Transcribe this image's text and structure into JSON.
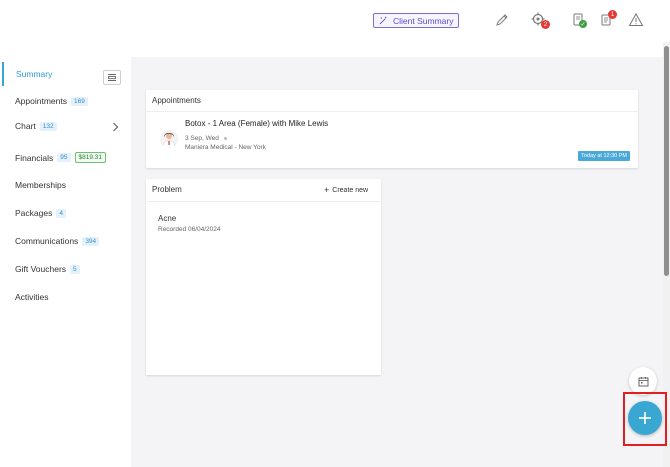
{
  "header": {
    "client_summary_label": "Client Summary",
    "icons": [
      "edit-icon",
      "target-icon",
      "document-check-icon",
      "notes-icon",
      "warning-icon"
    ],
    "target_badge": "2",
    "notes_badge": "1"
  },
  "sidebar": {
    "summary_label": "Summary",
    "items": [
      {
        "label": "Appointments",
        "count": "169"
      },
      {
        "label": "Chart",
        "count": "132"
      },
      {
        "label": "Financials",
        "count": "95",
        "amount": "$819.31"
      },
      {
        "label": "Memberships"
      },
      {
        "label": "Packages",
        "count": "4"
      },
      {
        "label": "Communications",
        "count": "394"
      },
      {
        "label": "Gift Vouchers",
        "count": "5"
      },
      {
        "label": "Activities"
      }
    ]
  },
  "appointments": {
    "title": "Appointments",
    "item": {
      "service": "Botox - 1 Area (Female) with Mike Lewis",
      "date": "3 Sep, Wed",
      "location": "Maniera Medical - New York",
      "time": "Today at 12:30 PM"
    }
  },
  "problem": {
    "title": "Problem",
    "create_label": "Create new",
    "item": {
      "name": "Acne",
      "recorded": "Recorded 06/04/2024"
    }
  },
  "colors": {
    "accent": "#3aa7d3",
    "client_summary": "#5b4ec8",
    "highlight": "#e02020"
  }
}
